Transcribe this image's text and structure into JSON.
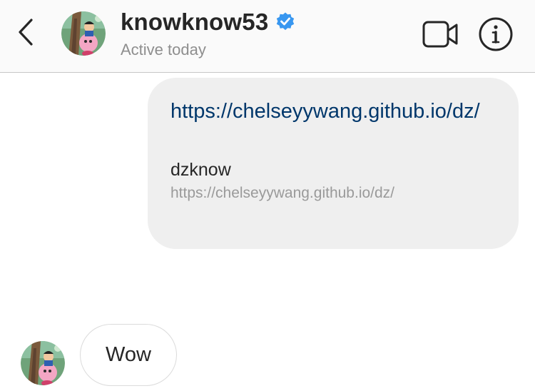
{
  "header": {
    "back_icon": "chevron-left-icon",
    "avatar_icon": "profile-avatar-icon",
    "username": "knowknow53",
    "verified_icon": "verified-badge-icon",
    "verified_color": "#3897f0",
    "status": "Active today",
    "video_icon": "video-call-icon",
    "info_icon": "info-icon"
  },
  "messages": [
    {
      "sender": "me",
      "type": "link",
      "url": "https://chelseyywang.github.io/dz/",
      "preview_title": "dzknow",
      "preview_url": "https://chelseyywang.github.io/dz/",
      "link_color": "#00376b",
      "bubble_color": "#efefef"
    },
    {
      "sender": "them",
      "type": "text",
      "text": "Wow",
      "avatar_icon": "profile-avatar-icon"
    }
  ]
}
